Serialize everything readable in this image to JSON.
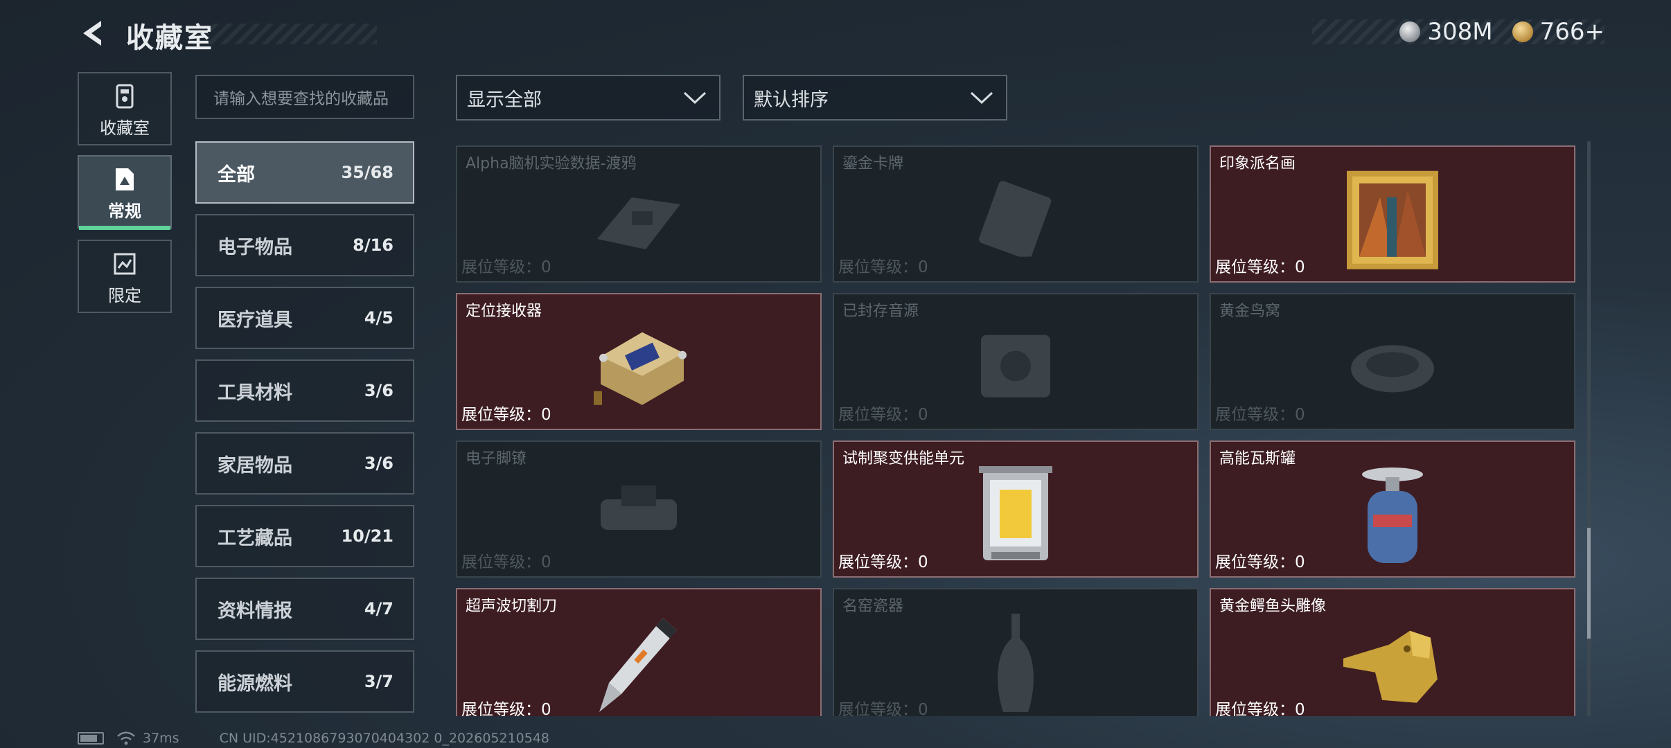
{
  "header": {
    "title": "收藏室",
    "silver_currency": "308M",
    "gold_currency": "766+"
  },
  "side_nav": [
    {
      "label": "收藏室",
      "icon": "collection-room-icon",
      "active": false
    },
    {
      "label": "常规",
      "icon": "regular-icon",
      "active": true
    },
    {
      "label": "限定",
      "icon": "limited-icon",
      "active": false
    }
  ],
  "search": {
    "placeholder": "请输入想要查找的收藏品"
  },
  "categories": [
    {
      "name": "全部",
      "count": "35/68",
      "active": true
    },
    {
      "name": "电子物品",
      "count": "8/16"
    },
    {
      "name": "医疗道具",
      "count": "4/5"
    },
    {
      "name": "工具材料",
      "count": "3/6"
    },
    {
      "name": "家居物品",
      "count": "3/6"
    },
    {
      "name": "工艺藏品",
      "count": "10/21"
    },
    {
      "name": "资料情报",
      "count": "4/7"
    },
    {
      "name": "能源燃料",
      "count": "3/7"
    }
  ],
  "filters": {
    "display": "显示全部",
    "sort": "默认排序"
  },
  "items": [
    {
      "name": "Alpha脑机实验数据-渡鸦",
      "level": "展位等级：0",
      "owned": false,
      "icon": "data-drive-icon"
    },
    {
      "name": "鎏金卡牌",
      "level": "展位等级：0",
      "owned": false,
      "icon": "gilded-card-icon"
    },
    {
      "name": "印象派名画",
      "level": "展位等级：0",
      "owned": true,
      "icon": "framed-painting-icon"
    },
    {
      "name": "定位接收器",
      "level": "展位等级：0",
      "owned": true,
      "icon": "locator-receiver-icon"
    },
    {
      "name": "已封存音源",
      "level": "展位等级：0",
      "owned": false,
      "icon": "sealed-audio-icon"
    },
    {
      "name": "黄金鸟窝",
      "level": "展位等级：0",
      "owned": false,
      "icon": "golden-nest-icon"
    },
    {
      "name": "电子脚镣",
      "level": "展位等级：0",
      "owned": false,
      "icon": "electronic-shackle-icon"
    },
    {
      "name": "试制聚变供能单元",
      "level": "展位等级：0",
      "owned": true,
      "icon": "fusion-unit-icon"
    },
    {
      "name": "高能瓦斯罐",
      "level": "展位等级：0",
      "owned": true,
      "icon": "gas-canister-icon"
    },
    {
      "name": "超声波切割刀",
      "level": "展位等级：0",
      "owned": true,
      "icon": "ultrasonic-cutter-icon"
    },
    {
      "name": "名窑瓷器",
      "level": "展位等级：0",
      "owned": false,
      "icon": "porcelain-vase-icon"
    },
    {
      "name": "黄金鳄鱼头雕像",
      "level": "展位等级：0",
      "owned": true,
      "icon": "golden-crocodile-icon"
    }
  ],
  "footer": {
    "ping": "37ms",
    "uid": "CN UID:4521086793070404302 0_202605210548"
  }
}
